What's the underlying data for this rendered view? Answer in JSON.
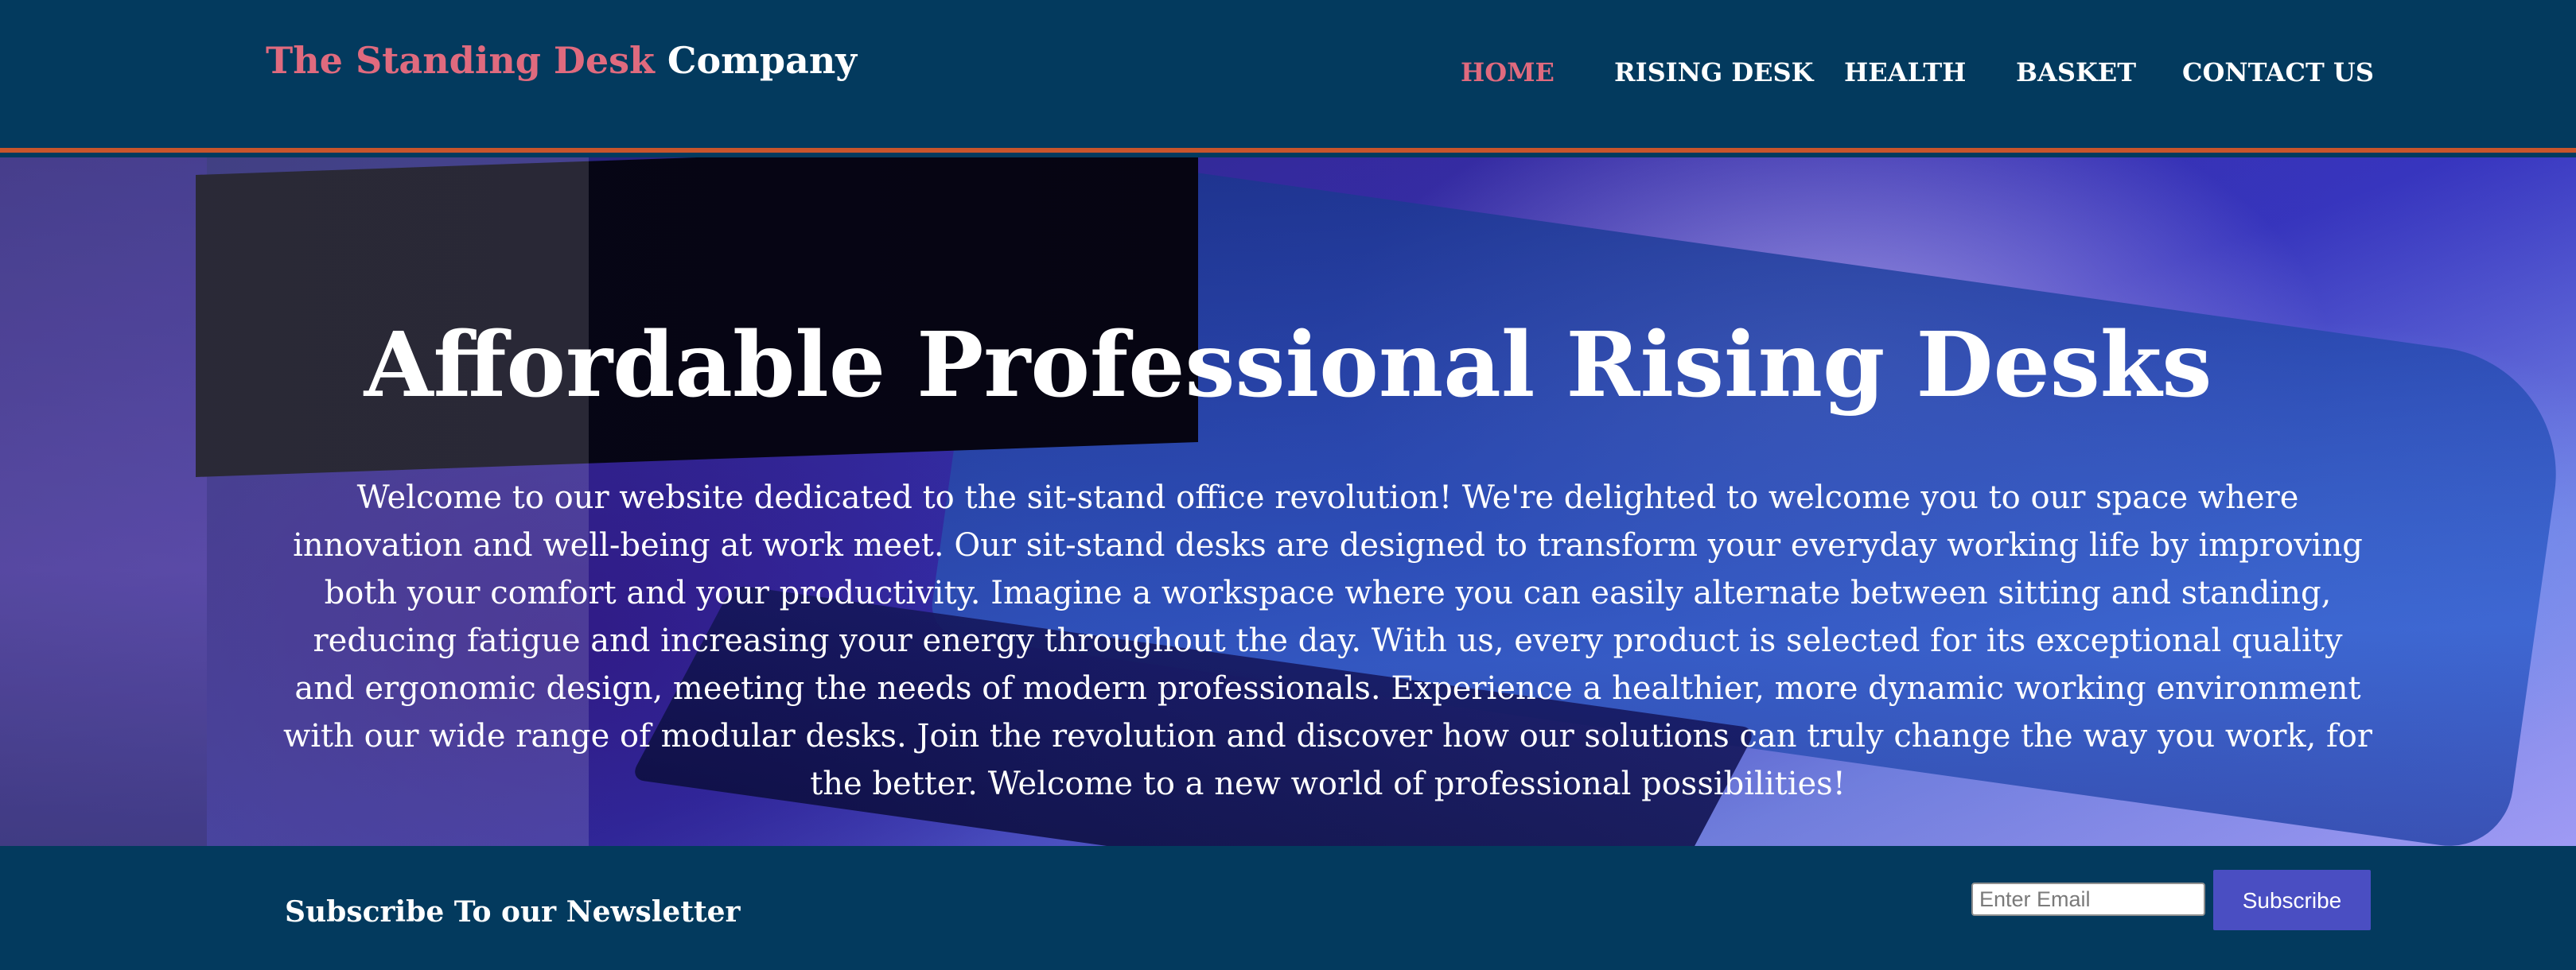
{
  "header": {
    "logo_accent": "The Standing Desk",
    "logo_plain": "Company",
    "nav": [
      {
        "label": "HOME",
        "active": true
      },
      {
        "label": "RISING DESK",
        "active": false
      },
      {
        "label": "HEALTH",
        "active": false
      },
      {
        "label": "BASKET",
        "active": false
      },
      {
        "label": "CONTACT US",
        "active": false
      }
    ]
  },
  "hero": {
    "title": "Affordable Professional Rising Desks",
    "text": "Welcome to our website dedicated to the sit-stand office revolution! We're delighted to welcome you to our space where innovation and well-being at work meet. Our sit-stand desks are designed to transform your everyday working life by improving both your comfort and your productivity. Imagine a workspace where you can easily alternate between sitting and standing, reducing fatigue and increasing your energy throughout the day. With us, every product is selected for its exceptional quality and ergonomic design, meeting the needs of modern professionals. Experience a healthier, more dynamic working environment with our wide range of modular desks. Join the revolution and discover how our solutions can truly change the way you work, for the better. Welcome to a new world of professional possibilities!"
  },
  "newsletter": {
    "title": "Subscribe To our Newsletter",
    "email_placeholder": "Enter Email",
    "email_value": "",
    "button_label": "Subscribe"
  },
  "colors": {
    "brand_navy": "#033a5e",
    "accent_pink": "#e06a7e",
    "divider_orange": "#c8552c",
    "button_purple": "#4a4ec2"
  }
}
